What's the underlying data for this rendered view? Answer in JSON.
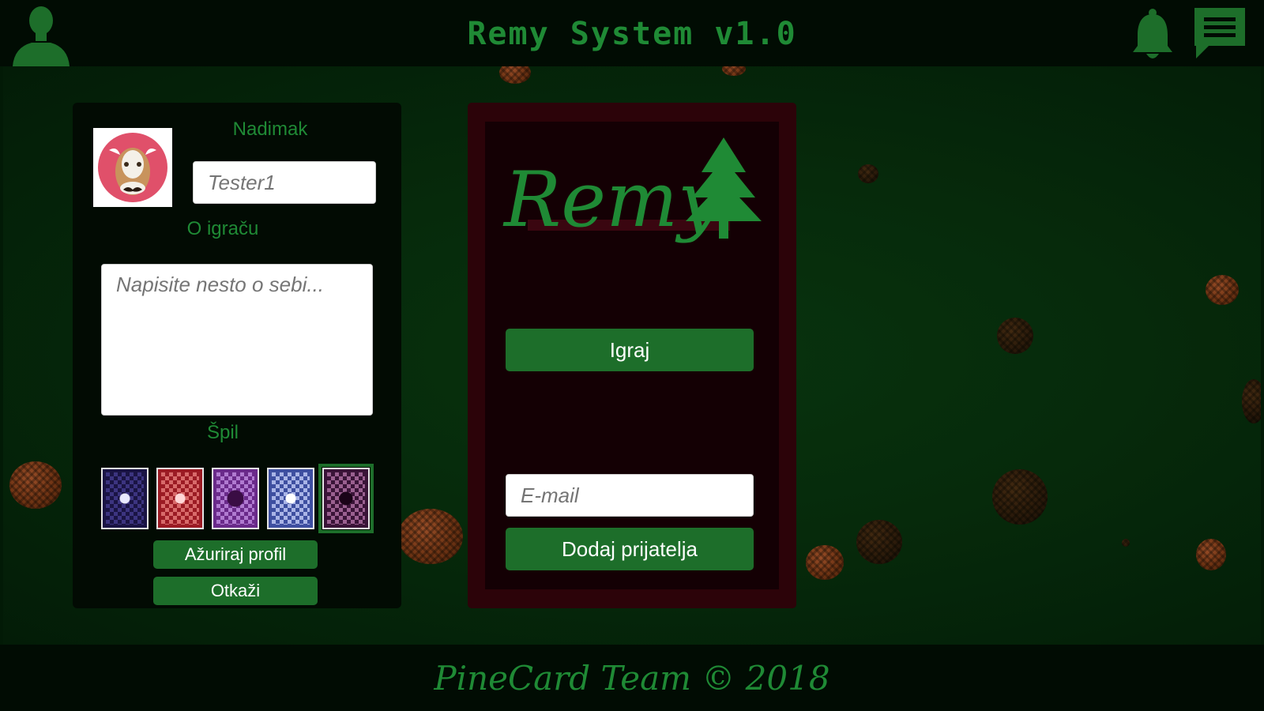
{
  "header": {
    "title": "Remy System v1.0"
  },
  "icons": {
    "user": "user-silhouette-icon",
    "bell": "bell-icon",
    "chat": "chat-message-icon"
  },
  "profile": {
    "nickname_label": "Nadimak",
    "nickname_placeholder": "Tester1",
    "about_label": "O igraču",
    "about_placeholder": "Napisite nesto o sebi...",
    "deck_label": "Špil",
    "decks": [
      "deck-navy",
      "deck-red",
      "deck-purple",
      "deck-blue",
      "deck-plum"
    ],
    "selected_deck": 4,
    "update_button": "Ažuriraj profil",
    "cancel_button": "Otkaži"
  },
  "game": {
    "logo_text": "Remy",
    "play_button": "Igraj",
    "email_placeholder": "E-mail",
    "add_friend_button": "Dodaj prijatelja"
  },
  "footer": {
    "text": "PineCard Team © 2018"
  },
  "colors": {
    "accent": "#1d6e2a",
    "title": "#1f8a35",
    "panel_dark": "#020b03",
    "panel_red": "#2c0309"
  }
}
